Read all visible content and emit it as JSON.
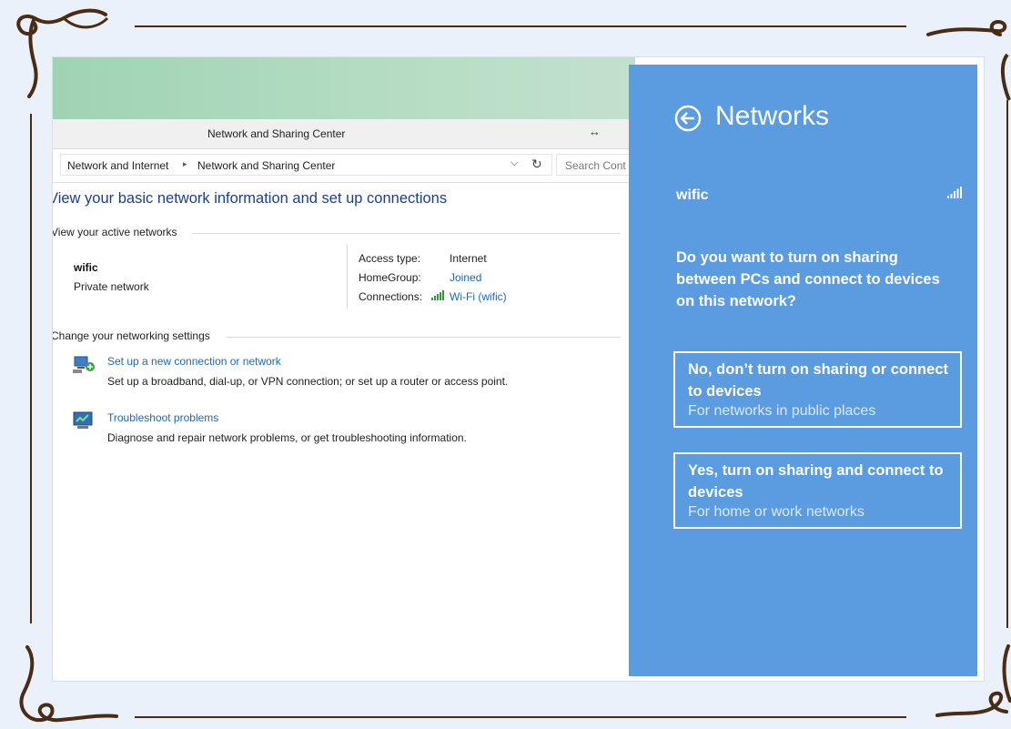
{
  "window": {
    "title": "Network and Sharing Center",
    "resize_glyph": "↔"
  },
  "address": {
    "crumbs": [
      "Network and Internet",
      "Network and Sharing Center"
    ],
    "separator": "▸",
    "dropdown_glyph": "⌵",
    "refresh_glyph": "↻",
    "search_placeholder": "Search Cont"
  },
  "main": {
    "heading": "View your basic network information and set up connections",
    "active_networks_label": "View your active networks",
    "network": {
      "name": "wific",
      "type": "Private network",
      "access_type_label": "Access type:",
      "access_type_value": "Internet",
      "homegroup_label": "HomeGroup:",
      "homegroup_value": "Joined",
      "connections_label": "Connections:",
      "connections_value": "Wi-Fi (wific)"
    },
    "settings_label": "Change your networking settings",
    "tasks": [
      {
        "link": "Set up a new connection or network",
        "desc": "Set up a broadband, dial-up, or VPN connection; or set up a router or access point.",
        "icon": "network-setup-icon"
      },
      {
        "link": "Troubleshoot problems",
        "desc": "Diagnose and repair network problems, or get troubleshooting information.",
        "icon": "troubleshoot-icon"
      }
    ]
  },
  "charm": {
    "title": "Networks",
    "ssid": "wific",
    "question": "Do you want to turn on sharing between PCs and connect to devices on this network?",
    "options": [
      {
        "main": "No, don’t turn on sharing or connect to devices",
        "sub": "For networks in public places"
      },
      {
        "main": "Yes, turn on sharing and connect to devices",
        "sub": "For home or work networks"
      }
    ]
  },
  "colors": {
    "charm_bg": "#5b9be0",
    "link": "#1c68b8",
    "heading": "#1d3f8a",
    "frame": "#4a2c14"
  }
}
